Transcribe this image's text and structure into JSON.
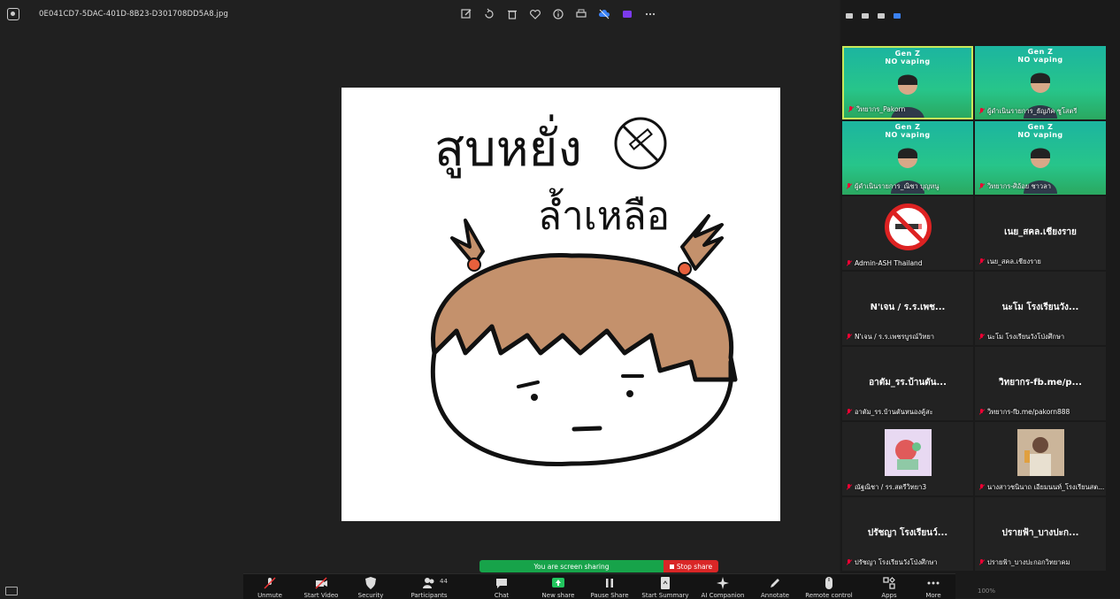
{
  "viewer": {
    "filename": "0E041CD7-5DAC-401D-8B23-D301708DD5A8.jpg",
    "tools": [
      "edit-icon",
      "rotate-icon",
      "delete-icon",
      "heart-icon",
      "info-icon",
      "print-icon",
      "cloud-icon",
      "clipchamp-icon",
      "more-icon"
    ],
    "image_title_line1": "สูบหยั่ง",
    "image_title_line2": "ล้ำเหลือ"
  },
  "gallery": {
    "video_header": "Gen Z",
    "video_subheader": "NO vaping",
    "tiles": [
      {
        "label": "วิทยากร_Pakorn",
        "type": "video",
        "active": true
      },
      {
        "label": "ผู้ดำเนินรายการ_ธัญภัค ชูโสตรี",
        "type": "video"
      },
      {
        "label": "ผู้ดำเนินรายการ_ณิชา บุญหนู",
        "type": "video"
      },
      {
        "label": "วิทยากร-ศิอ้อย ชาวลา",
        "type": "video"
      },
      {
        "label": "Admin-ASH Thailand",
        "type": "logo"
      },
      {
        "label": "เนย_สคล.เชียงราย",
        "name": "เนย_สคล.เชียงราย",
        "type": "name"
      },
      {
        "label": "N'เจน / ร.ร.เพชรบูรณ์วิทยา",
        "name": "N'เจน / ร.ร.เพช...",
        "type": "name"
      },
      {
        "label": "นะโม โรงเรียนวังโป่งศึกษา",
        "name": "นะโม โรงเรียนวัง...",
        "type": "name"
      },
      {
        "label": "อาตัม_รร.บ้านตันหนองคู้สะ",
        "name": "อาตัม_รร.บ้านตัน...",
        "type": "name"
      },
      {
        "label": "วิทยากร-fb.me/pakorn888",
        "name": "วิทยากร-fb.me/p...",
        "type": "name"
      },
      {
        "label": "ณัฐณิชา / รร.สตรีวิทยา3",
        "type": "thumb1"
      },
      {
        "label": "นางสาวชนินาถ เอียมนนท์_โรงเรียนสต...",
        "type": "thumb2"
      },
      {
        "label": "ปรัชญา โรงเรียนวังโป่งศึกษา",
        "name": "ปรัชญา โรงเรียนว์...",
        "type": "name"
      },
      {
        "label": "ปรายฟ้า_บางปะกอกวิทยาคม",
        "name": "ปรายฟ้า_บางปะก...",
        "type": "name"
      }
    ]
  },
  "share_bar": {
    "status": "You are screen sharing",
    "stop_label": "Stop share"
  },
  "toolbar": {
    "items": [
      {
        "label": "Unmute",
        "icon": "mic-muted-icon"
      },
      {
        "label": "Start Video",
        "icon": "video-off-icon"
      },
      {
        "label": "Security",
        "icon": "shield-icon"
      },
      {
        "label": "Participants",
        "icon": "participants-icon",
        "count": "44"
      },
      {
        "label": "Chat",
        "icon": "chat-icon"
      },
      {
        "label": "New share",
        "icon": "share-icon"
      },
      {
        "label": "Pause Share",
        "icon": "pause-icon"
      },
      {
        "label": "Start Summary",
        "icon": "summary-icon"
      },
      {
        "label": "AI Companion",
        "icon": "sparkle-icon"
      },
      {
        "label": "Annotate",
        "icon": "pen-icon"
      },
      {
        "label": "Remote control",
        "icon": "mouse-icon"
      },
      {
        "label": "Apps",
        "icon": "apps-icon"
      },
      {
        "label": "More",
        "icon": "more-icon"
      }
    ]
  },
  "zoom_level": "100%"
}
